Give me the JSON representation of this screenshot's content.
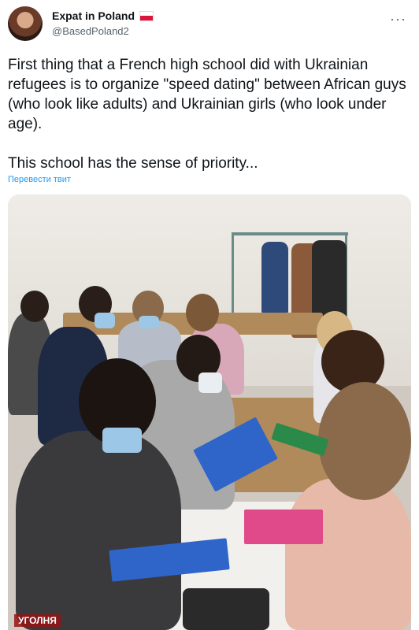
{
  "tweet": {
    "display_name": "Expat in Poland",
    "handle": "@BasedPoland2",
    "text": "First thing that a French high school did with Ukrainian refugees is to organize \"speed dating\" between African guys (who look like adults) and Ukrainian girls (who look under age).\n\nThis school has the sense of priority...",
    "translate_label": "Перевести твит",
    "more_icon": "more-icon"
  },
  "photo": {
    "watermark": "УГОЛНЯ"
  },
  "colors": {
    "link": "#1d9bf0",
    "flag_red": "#dc143c",
    "muted_text": "#536471"
  }
}
